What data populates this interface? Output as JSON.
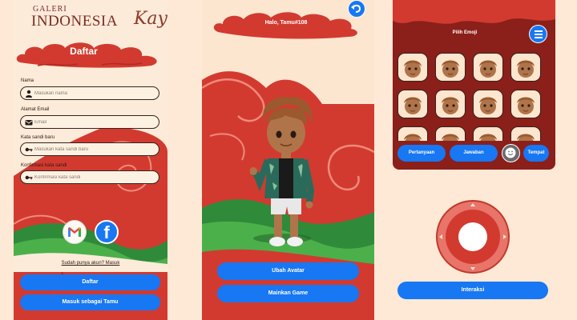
{
  "register": {
    "logo": {
      "line1": "GALERI",
      "line2": "INDONESIA",
      "line3": "Kaya"
    },
    "title": "Daftar",
    "fields": [
      {
        "label": "Nama",
        "placeholder": "Masukan nama",
        "icon": "person-icon"
      },
      {
        "label": "Alamat Email",
        "placeholder": "Email",
        "icon": "mail-icon"
      },
      {
        "label": "Kata sandi baru",
        "placeholder": "Masukan kata sandi baru",
        "icon": "key-icon"
      },
      {
        "label": "Konfirmasi kata sandi",
        "placeholder": "Konfirmasi kata sandi",
        "icon": "key-icon"
      }
    ],
    "social_icons": [
      "gmail-icon",
      "facebook-icon"
    ],
    "facebook_glyph": "f",
    "signin_link": "Sudah punya akun? Masuk",
    "register_button": "Daftar",
    "guest_button": "Masuk sebagai Tamu"
  },
  "avatar_screen": {
    "greeting": "Halo, Tamu#108",
    "back_icon": "undo-icon",
    "change_avatar_button": "Ubah Avatar",
    "play_button": "Mainkan Game"
  },
  "emoji_screen": {
    "title": "Pilih Emoji",
    "menu_icon": "hamburger-menu-icon",
    "emoji_count_visible": 12,
    "tabs": [
      "Pertanyaan",
      "Jawaban",
      "Tempat"
    ],
    "smile_icon": "smile-icon",
    "interact_button": "Interaksi"
  },
  "colors": {
    "accent_blue": "#1877f2",
    "cloud_red": "#d23a30",
    "dark_red": "#8b1f1a",
    "background": "#fde9d5",
    "grass_green": "#2f8a3a"
  }
}
